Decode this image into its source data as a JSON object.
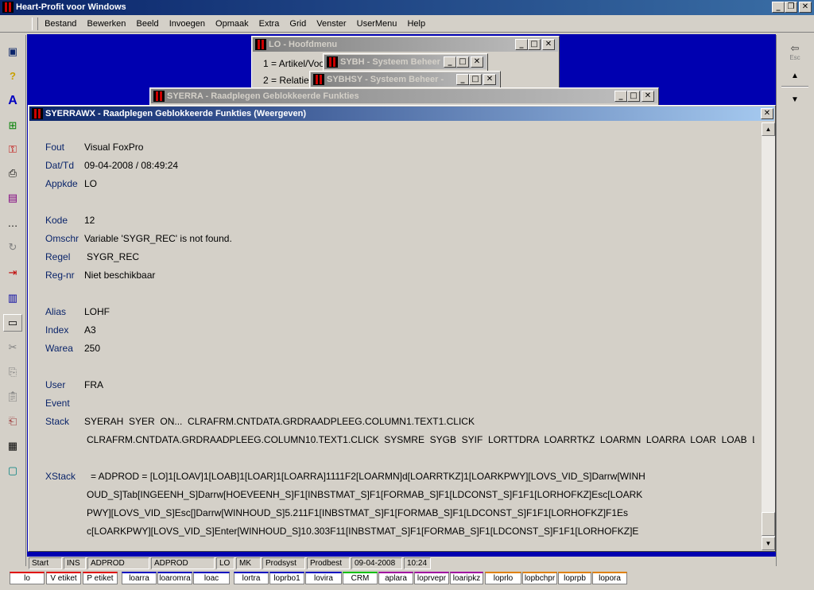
{
  "app": {
    "title": "Heart-Profit voor Windows"
  },
  "menu": [
    "Bestand",
    "Bewerken",
    "Beeld",
    "Invoegen",
    "Opmaak",
    "Extra",
    "Grid",
    "Venster",
    "UserMenu",
    "Help"
  ],
  "windows": {
    "hoofdmenu": {
      "title": "LO - Hoofdmenu",
      "items": [
        "1 = Artikel/Voo",
        "2 = Relatie"
      ]
    },
    "sybh": {
      "title": "SYBH - Systeem Beheer"
    },
    "sybhsy": {
      "title": "SYBHSY - Systeem Beheer -"
    },
    "syerra": {
      "title": "SYERRA - Raadplegen Geblokkeerde Funkties"
    },
    "syerrawx": {
      "title": "SYERRAWX - Raadplegen Geblokkeerde Funkties (Weergeven)"
    }
  },
  "fields": {
    "fout": {
      "label": "Fout",
      "value": "Visual FoxPro"
    },
    "dattd": {
      "label": "Dat/Td",
      "value": "09-04-2008 / 08:49:24"
    },
    "appkde": {
      "label": "Appkde",
      "value": "LO"
    },
    "kode": {
      "label": "Kode",
      "value": "12"
    },
    "omschr": {
      "label": "Omschr",
      "value": "Variable 'SYGR_REC' is not found."
    },
    "regel": {
      "label": "Regel",
      "value": "SYGR_REC"
    },
    "regnr": {
      "label": "Reg-nr",
      "value": "Niet beschikbaar"
    },
    "alias": {
      "label": "Alias",
      "value": "LOHF"
    },
    "index": {
      "label": "Index",
      "value": "A3"
    },
    "warea": {
      "label": "Warea",
      "value": "250"
    },
    "user": {
      "label": "User",
      "value": "FRA"
    },
    "event": {
      "label": "Event",
      "value": ""
    },
    "stack": {
      "label": "Stack",
      "line1": "SYERAH  SYER  ON...  CLRAFRM.CNTDATA.GRDRAADPLEEG.COLUMN1.TEXT1.CLICK",
      "line2": "CLRAFRM.CNTDATA.GRDRAADPLEEG.COLUMN10.TEXT1.CLICK  SYSMRE  SYGB  SYIF  LORTTDRA  LOARRTKZ  LOARMN  LOARRA  LOAR  LOAB  LOA"
    },
    "xstack": {
      "label": "XStack",
      "line1": "= ADPROD = [LO]1[LOAV]1[LOAB]1[LOAR]1[LOARRA]1111F2[LOARMN]d[LOARRTKZ]1[LOARKPWY][LOVS_VID_S]Darrw[WINH",
      "line2": "OUD_S]Tab[INGEENH_S]Darrw[HOEVEENH_S]F1[INBSTMAT_S]F1[FORMAB_S]F1[LDCONST_S]F1F1[LORHOFKZ]Esc[LOARK",
      "line3": "PWY][LOVS_VID_S]Esc[]Darrw[WINHOUD_S]5.211F1[INBSTMAT_S]F1[FORMAB_S]F1[LDCONST_S]F1F1[LORHOFKZ]F1Es",
      "line4": "c[LOARKPWY][LOVS_VID_S]Enter[WINHOUD_S]10.303F11[INBSTMAT_S]F1[FORMAB_S]F1[LDCONST_S]F1F1[LORHOFKZ]E"
    }
  },
  "statusbar": [
    "Start",
    "INS",
    "ADPROD",
    "ADPROD",
    "LO",
    "MK",
    "Prodsyst",
    "Prodbest",
    "09-04-2008",
    "10:24"
  ],
  "tabs": [
    "lo",
    "V etiket",
    "P etiket",
    "loarra",
    "loaromra",
    "loac",
    "lortra",
    "loprbo1",
    "lovira",
    "CRM",
    "aplara",
    "loprvepr",
    "loaripkz",
    "loprlo",
    "lopbchpr",
    "loprpb",
    "lopora"
  ],
  "rightbar": {
    "esc_label": "Esc"
  }
}
